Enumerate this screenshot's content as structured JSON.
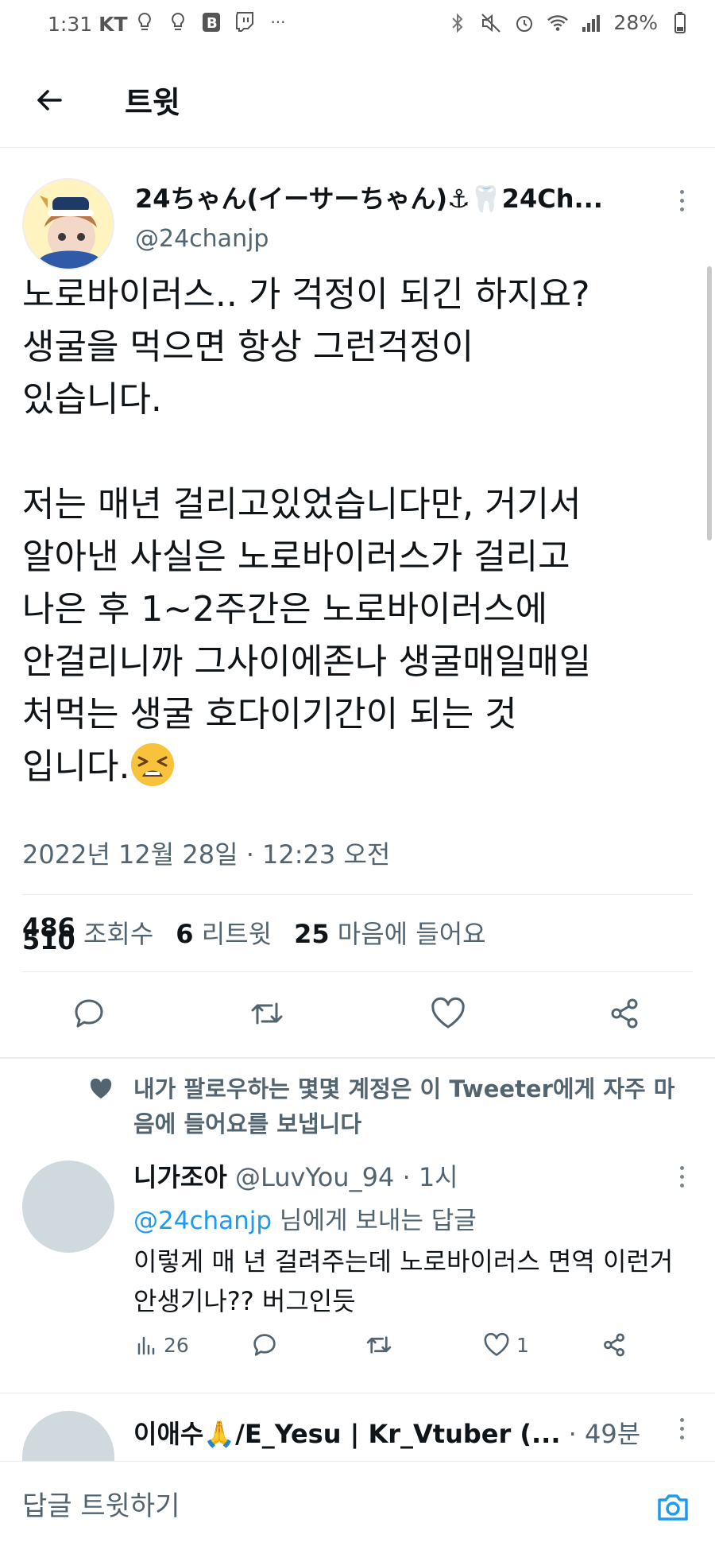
{
  "status_bar": {
    "time": "1:31",
    "carrier": "KT",
    "battery": "28%"
  },
  "header": {
    "title": "트윗"
  },
  "tweet": {
    "author_name": "24ちゃん(イーサーちゃん)⚓🦷24Ch...",
    "author_handle": "@24chanjp",
    "body": "노로바이러스.. 가 걱정이 되긴 하지요?\n생굴을 먹으면 항상 그런걱정이\n있습니다.\n\n저는 매년 걸리고있었습니다만, 거기서\n알아낸 사실은 노로바이러스가 걸리고\n나은 후 1~2주간은 노로바이러스에\n안걸리니까 그사이에존나 생굴매일매일\n처먹는 생굴 호다이기간이 되는 것\n입니다.",
    "date": "2022년 12월 28일 · 12:23 오전",
    "stats": {
      "views_count": "486",
      "views_count_old": "510",
      "views_label": "조회수",
      "retweets_count": "6",
      "retweets_label": "리트윗",
      "likes_count": "25",
      "likes_label": "마음에 들어요"
    }
  },
  "social_context": "내가 팔로우하는 몇몇 계정은 이 Tweeter에게 자주 마음에 들어요를 보냅니다",
  "replies": [
    {
      "name": "니가조아",
      "handle": "@LuvYou_94",
      "time": "· 1시",
      "reply_to_mention": "@24chanjp",
      "reply_to_suffix": " 님에게 보내는 답글",
      "text": "이렇게 매 년 걸려주는데 노로바이러스 면역 이런거 안생기나?? 버그인듯",
      "views": "26",
      "likes": "1"
    },
    {
      "name": "이애수🙏/E_Yesu | Kr_Vtuber (...",
      "time": "· 49분"
    }
  ],
  "compose": {
    "placeholder": "답글 트윗하기"
  },
  "colors": {
    "accent": "#1d9bf0",
    "text": "#0f1419",
    "secondary": "#536471"
  }
}
